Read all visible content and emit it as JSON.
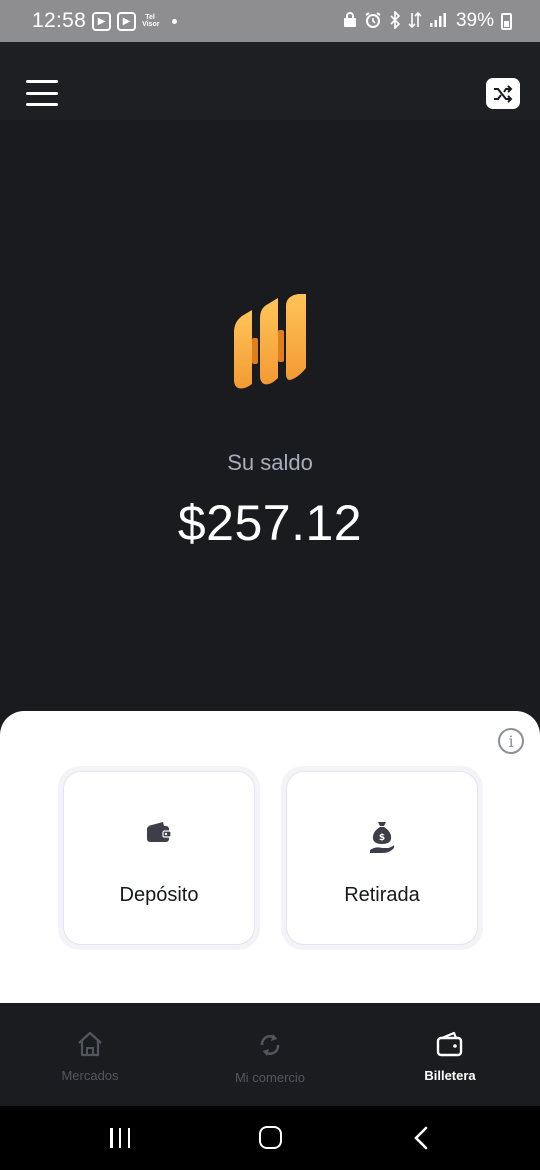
{
  "status_bar": {
    "time": "12:58",
    "small_app_text": "Tel Visor",
    "battery_percent": "39%"
  },
  "header": {
    "menu_icon": "hamburger-icon",
    "action_icon": "shuffle-icon"
  },
  "wallet": {
    "balance_label": "Su saldo",
    "balance_value": "$257.12",
    "accent_color": "#f5a33b"
  },
  "actions": [
    {
      "label": "Depósito",
      "icon": "wallet-icon"
    },
    {
      "label": "Retirada",
      "icon": "money-bag-hand-icon"
    }
  ],
  "info_icon": "info-icon",
  "bottom_nav": {
    "items": [
      {
        "label": "Mercados",
        "icon": "home-icon",
        "active": false
      },
      {
        "label": "Mi comercio",
        "icon": "refresh-icon",
        "active": false
      },
      {
        "label": "Billetera",
        "icon": "wallet-nav-icon",
        "active": true
      }
    ]
  },
  "system_nav": {
    "recent_icon": "recent-apps-icon",
    "home_icon": "home-button-icon",
    "back_icon": "back-icon"
  }
}
